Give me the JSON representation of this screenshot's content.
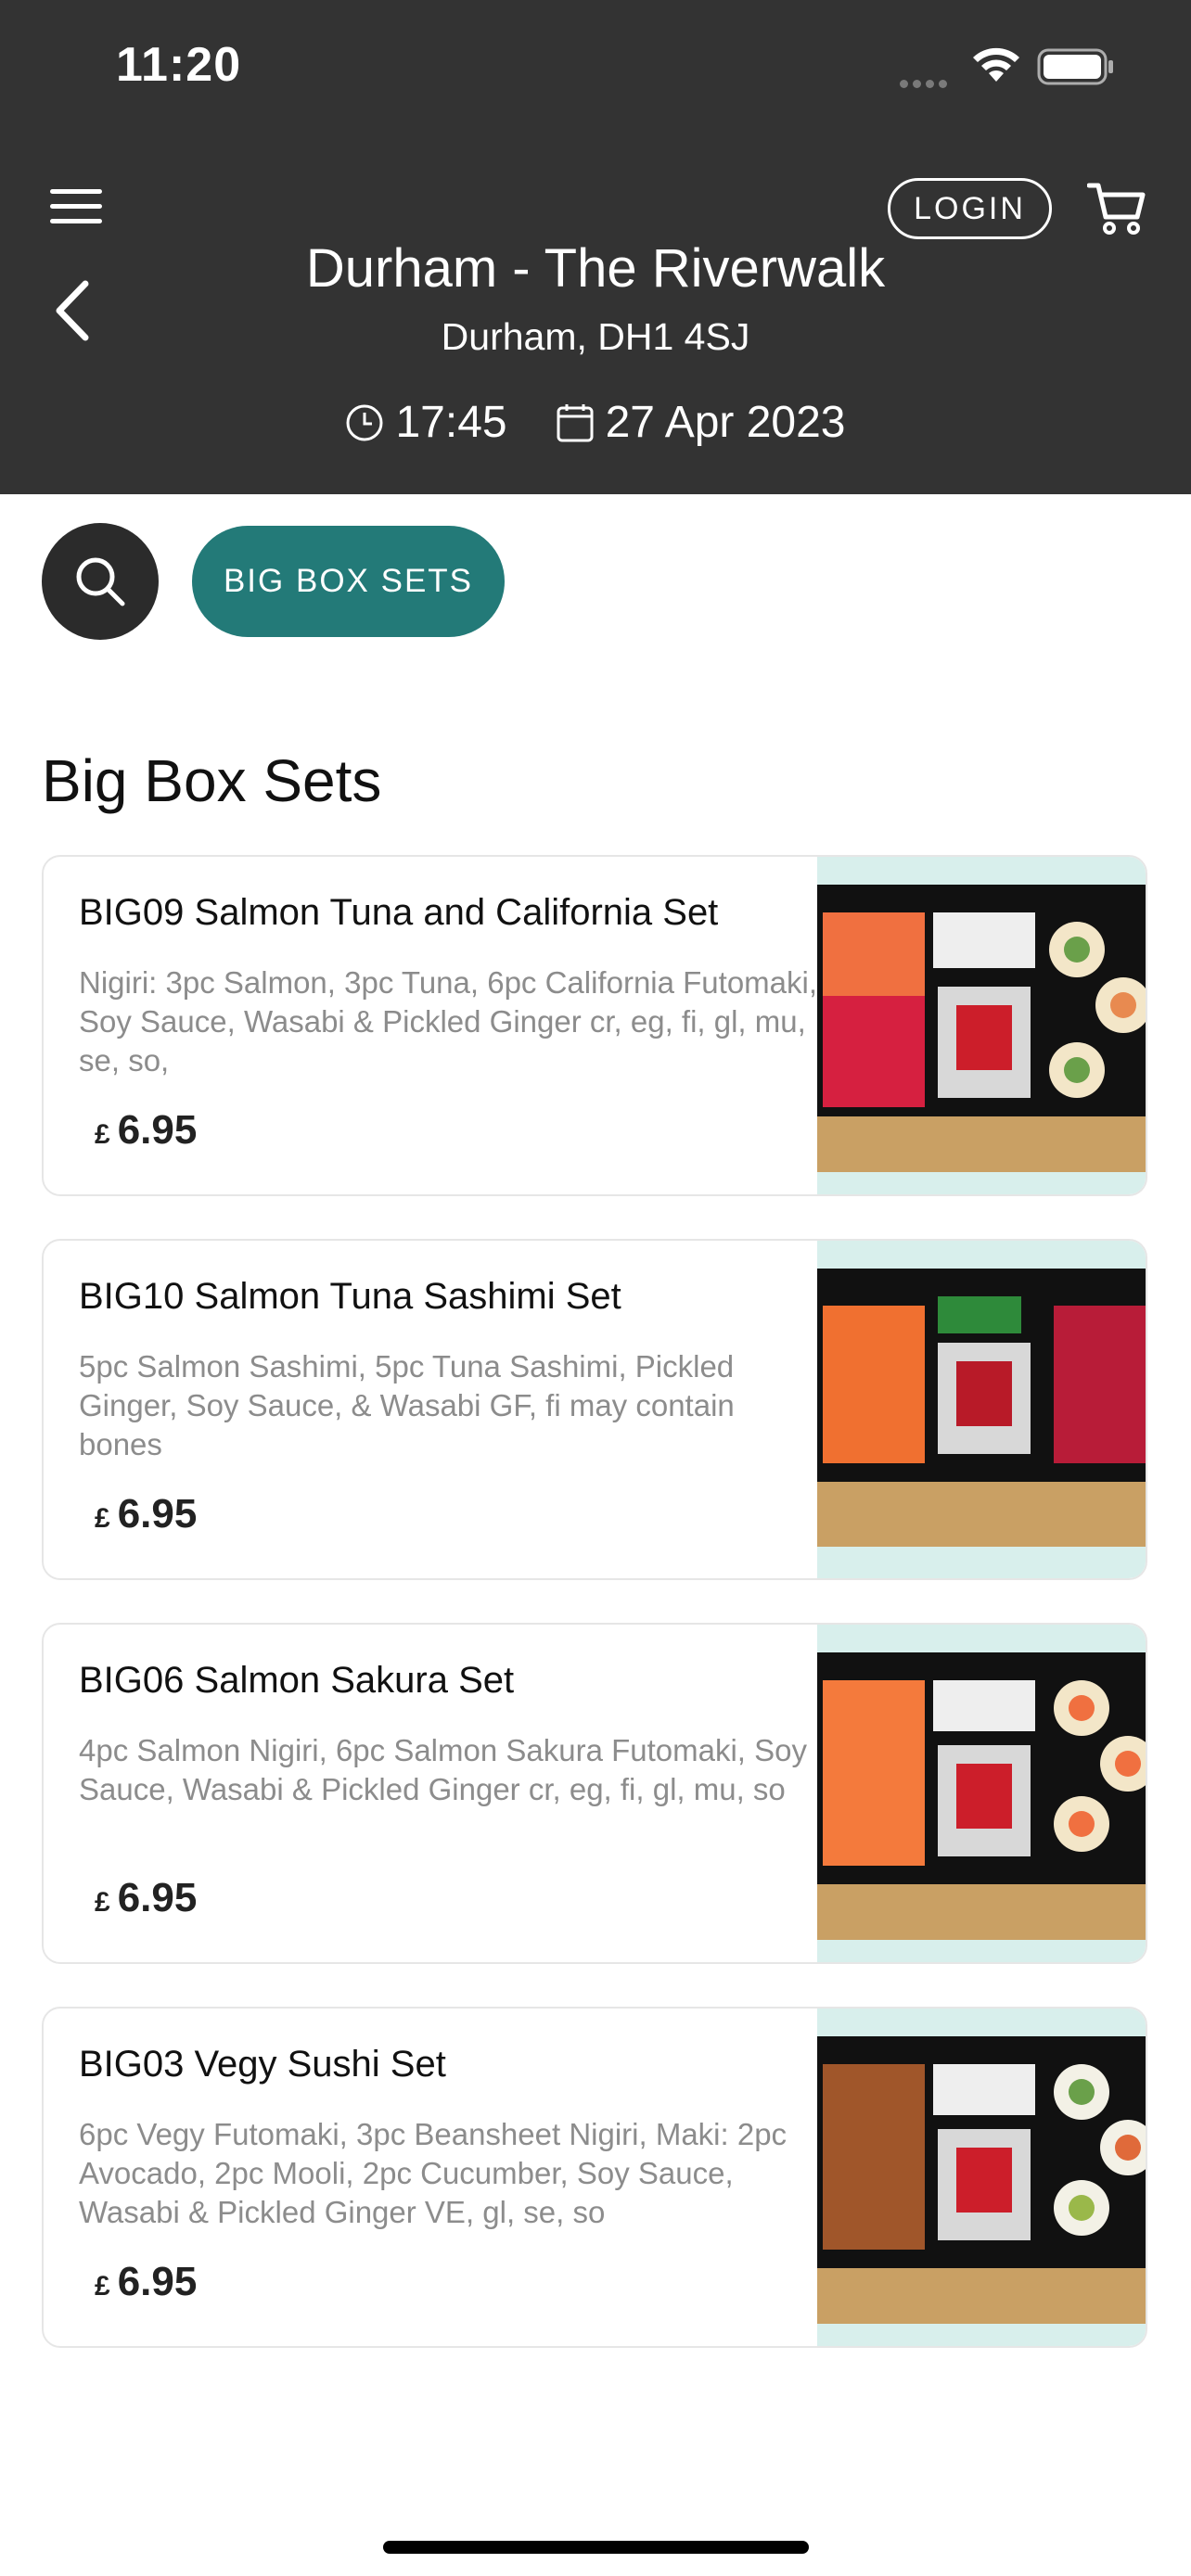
{
  "status_bar": {
    "time": "11:20"
  },
  "header": {
    "login_label": "LOGIN",
    "store_name": "Durham - The Riverwalk",
    "store_address": "Durham, DH1 4SJ",
    "time": "17:45",
    "date": "27 Apr 2023"
  },
  "category_chip": "BIG BOX SETS",
  "section_title": "Big Box Sets",
  "colors": {
    "header_bg": "#333333",
    "accent": "#237a78"
  },
  "products": [
    {
      "title": "BIG09 Salmon Tuna and California Set",
      "description": "Nigiri: 3pc Salmon, 3pc Tuna, 6pc California Futomaki, Soy Sauce, Wasabi & Pickled Ginger cr, eg, fi, gl, mu, se, so,",
      "currency": "£",
      "price": "6.95"
    },
    {
      "title": "BIG10 Salmon Tuna Sashimi Set",
      "description": "5pc Salmon Sashimi, 5pc Tuna Sashimi, Pickled Ginger, Soy Sauce, & Wasabi GF, fi may contain bones",
      "currency": "£",
      "price": "6.95"
    },
    {
      "title": "BIG06 Salmon Sakura Set",
      "description": "4pc Salmon Nigiri, 6pc Salmon Sakura Futomaki, Soy Sauce, Wasabi & Pickled Ginger cr, eg, fi, gl, mu, so",
      "currency": "£",
      "price": "6.95"
    },
    {
      "title": "BIG03 Vegy Sushi Set",
      "description": "6pc Vegy Futomaki, 3pc Beansheet Nigiri, Maki: 2pc Avocado, 2pc Mooli, 2pc Cucumber, Soy Sauce, Wasabi & Pickled Ginger VE, gl, se, so",
      "currency": "£",
      "price": "6.95"
    }
  ]
}
